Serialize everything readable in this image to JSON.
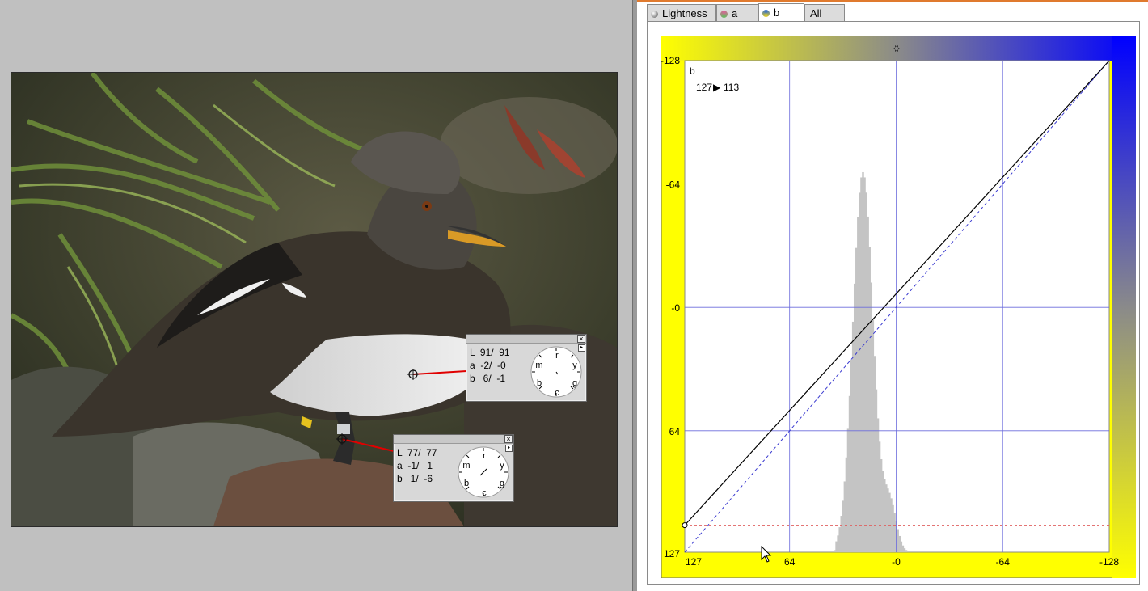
{
  "tabs": [
    {
      "label": "Lightness",
      "icon": "lightness-icon",
      "active": false
    },
    {
      "label": "a",
      "icon": "a-channel-icon",
      "active": false
    },
    {
      "label": "b",
      "icon": "b-channel-icon",
      "active": true
    },
    {
      "label": "All",
      "icon": "",
      "active": false
    }
  ],
  "curve": {
    "channel_label": "b",
    "readout_in": "127",
    "readout_arrow": "▶",
    "readout_out": "113",
    "y_ticks": [
      "-128",
      "-64",
      "-0",
      "64",
      "127"
    ],
    "x_ticks": [
      "127",
      "64",
      "-0",
      "-64",
      "-128"
    ],
    "colors": {
      "grid": "#6a6adc",
      "curve": "#000000",
      "baseline": "#3a3ad0",
      "marker": "#e06060",
      "histogram": "#c4c4c4",
      "yellow": "#ffff00",
      "blue": "#0000ff"
    },
    "curve_points": [
      [
        127,
        113
      ],
      [
        -128,
        -128
      ]
    ],
    "marker_input": 127,
    "marker_output": 113
  },
  "samplers": [
    {
      "L": "L  91/  91",
      "a": "a  -2/  -0",
      "b": "b   6/  -1",
      "dial": [
        "r",
        "y",
        "g",
        "c",
        "b",
        "m"
      ]
    },
    {
      "L": "L  77/  77",
      "a": "a  -1/   1",
      "b": "b   1/  -6",
      "dial": [
        "r",
        "y",
        "g",
        "c",
        "b",
        "m"
      ]
    }
  ],
  "icons": {
    "close": "×",
    "menu": "▸"
  }
}
